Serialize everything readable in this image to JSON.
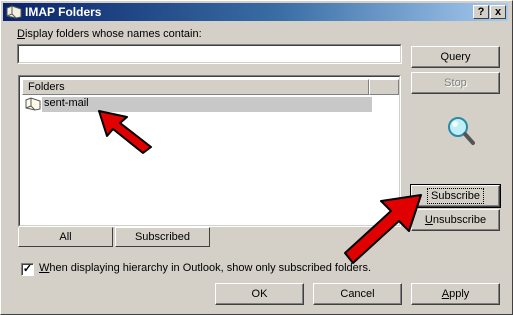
{
  "window": {
    "title": "IMAP Folders",
    "help_btn": "?",
    "close_btn": "x"
  },
  "filter": {
    "label": "Display folders whose names contain:",
    "value": ""
  },
  "folder_list": {
    "column_header": "Folders",
    "items": [
      {
        "label": "sent-mail",
        "selected": true
      }
    ]
  },
  "buttons": {
    "query": "Query",
    "stop": "Stop",
    "subscribe": "Subscribe",
    "unsubscribe": "Unsubscribe",
    "ok": "OK",
    "cancel": "Cancel",
    "apply": "Apply"
  },
  "tabs": [
    {
      "label": "All",
      "active": true
    },
    {
      "label": "Subscribed",
      "active": false
    }
  ],
  "option": {
    "checked": true,
    "label": "When displaying hierarchy in Outlook, show only subscribed folders."
  },
  "colors": {
    "titlebar_start": "#0a246a",
    "titlebar_end": "#a6caf0",
    "dialog_bg": "#d4d0c8",
    "annotation_arrow": "#e00000"
  },
  "icons": {
    "title": "imap-folder-icon",
    "item": "folder-icon",
    "status": "magnifier-icon"
  }
}
